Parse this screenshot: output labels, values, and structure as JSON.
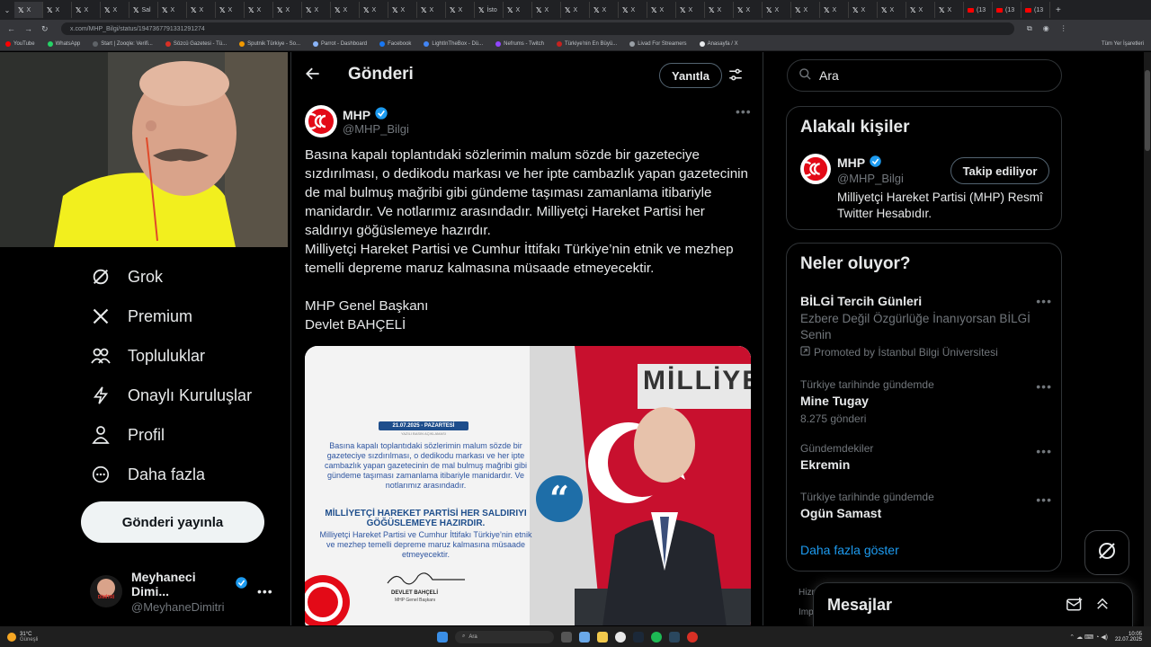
{
  "browser": {
    "tabs": [
      {
        "label": "X"
      },
      {
        "label": "X"
      },
      {
        "label": "X"
      },
      {
        "label": "X"
      },
      {
        "label": "Sal"
      },
      {
        "label": "X"
      },
      {
        "label": "X"
      },
      {
        "label": "X"
      },
      {
        "label": "X"
      },
      {
        "label": "X"
      },
      {
        "label": "X"
      },
      {
        "label": "X"
      },
      {
        "label": "X"
      },
      {
        "label": "X"
      },
      {
        "label": "X"
      },
      {
        "label": "X"
      },
      {
        "label": "İsto"
      },
      {
        "label": "X"
      },
      {
        "label": "X"
      },
      {
        "label": "X"
      },
      {
        "label": "X"
      },
      {
        "label": "X"
      },
      {
        "label": "X"
      },
      {
        "label": "X"
      },
      {
        "label": "X"
      },
      {
        "label": "X"
      },
      {
        "label": "X"
      },
      {
        "label": "X"
      },
      {
        "label": "X"
      },
      {
        "label": "X"
      },
      {
        "label": "X"
      },
      {
        "label": "X"
      },
      {
        "label": "X"
      },
      {
        "label": "(13"
      },
      {
        "label": "(13"
      },
      {
        "label": "(13"
      }
    ],
    "url": "x.com/MHP_Bilgi/status/1947367791331291274",
    "bookmarks": [
      {
        "label": "YouTube",
        "color": "#ff0000"
      },
      {
        "label": "WhatsApp",
        "color": "#25d366"
      },
      {
        "label": "Start | Zooqle: Verifi...",
        "color": "#5f6368"
      },
      {
        "label": "Sözcü Gazetesi - Tü...",
        "color": "#d93025"
      },
      {
        "label": "Sputnik Türkiye - So...",
        "color": "#f29900"
      },
      {
        "label": "Parrot - Dashboard",
        "color": "#8ab4f8"
      },
      {
        "label": "Facebook",
        "color": "#1877f2"
      },
      {
        "label": "LightInTheBox - Dü...",
        "color": "#4285f4"
      },
      {
        "label": "Nefrums - Twitch",
        "color": "#9146ff"
      },
      {
        "label": "Türkiye'nin En Büyü...",
        "color": "#c5221f"
      },
      {
        "label": "Livad For Streamers",
        "color": "#9aa0a6"
      },
      {
        "label": "Anasayfa / X",
        "color": "#e8eaed"
      }
    ],
    "bookmarks_right": "Tüm Yer İşaretleri"
  },
  "sidebar": {
    "items": [
      {
        "label": "Grok",
        "icon": "grok-icon"
      },
      {
        "label": "Premium",
        "icon": "x-logo-icon"
      },
      {
        "label": "Topluluklar",
        "icon": "communities-icon"
      },
      {
        "label": "Onaylı Kuruluşlar",
        "icon": "lightning-icon"
      },
      {
        "label": "Profil",
        "icon": "profile-icon"
      },
      {
        "label": "Daha fazla",
        "icon": "more-circle-icon"
      }
    ],
    "post_button": "Gönderi yayınla",
    "account": {
      "name": "Meyhaneci Dimi...",
      "handle": "@MeyhaneDimitri",
      "avatar_text": "DİMİTRİ"
    }
  },
  "main": {
    "title": "Gönderi",
    "reply_button": "Yanıtla",
    "author_name": "MHP",
    "author_handle": "@MHP_Bilgi",
    "post_text": "Basına kapalı toplantıdaki sözlerimin malum sözde bir gazeteciye sızdırılması, o dedikodu markası ve her ipte cambazlık yapan gazetecinin de mal bulmuş mağribi gibi gündeme taşıması zamanlama itibariyle manidardır. Ve notlarımız arasındadır. Milliyetçi Hareket Partisi her saldırıyı göğüslemeye hazırdır.\nMilliyetçi Hareket Partisi ve Cumhur İttifakı Türkiye’nin etnik ve mezhep temelli depreme maruz kalmasına müsaade etmeyecektir.\n\nMHP Genel Başkanı\nDevlet BAHÇELİ",
    "image": {
      "date_banner": "21.07.2025 - PAZARTESİ",
      "date_sub": "YAZILI BASIN AÇIKLAMASI",
      "body": "Basına kapalı toplantıdaki sözlerimin malum sözde bir gazeteciye sızdırılması, o dedikodu markası ve her ipte cambazlık yapan gazetecinin de mal bulmuş mağribi gibi gündeme taşıması zamanlama itibariyle manidardır. Ve notlarımız arasındadır.",
      "highlight": "MİLLİYETÇİ HAREKET PARTİSİ HER SALDIRIYI GÖĞÜSLEMEYE HAZIRDIR.",
      "body2": "Milliyetçi Hareket Partisi ve Cumhur İttifakı Türkiye’nin etnik ve mezhep temelli depreme maruz kalmasına müsaade etmeyecektir.",
      "signature_name": "DEVLET BAHÇELİ",
      "signature_title": "MHP Genel Başkanı",
      "wall_text": "MİLLİYET"
    }
  },
  "right": {
    "search_placeholder": "Ara",
    "related_title": "Alakalı kişiler",
    "related": {
      "name": "MHP",
      "handle": "@MHP_Bilgi",
      "follow_label": "Takip ediliyor",
      "bio": "Milliyetçi Hareket Partisi (MHP) Resmî Twitter Hesabıdır."
    },
    "trends_title": "Neler oluyor?",
    "promo": {
      "name": "BİLGİ Tercih Günleri",
      "desc": "Ezbere Değil Özgürlüğe İnanıyorsan BİLGİ Senin",
      "promoted": "Promoted by İstanbul Bilgi Üniversitesi"
    },
    "trends": [
      {
        "meta": "Türkiye tarihinde gündemde",
        "name": "Mine Tugay",
        "count": "8.275 gönderi"
      },
      {
        "meta": "Gündemdekiler",
        "name": "Ekremin",
        "count": ""
      },
      {
        "meta": "Türkiye tarihinde gündemde",
        "name": "Ogün Samast",
        "count": ""
      }
    ],
    "show_more": "Daha fazla göster",
    "footer_partial_1": "Hizr",
    "footer_partial_2": "Impr",
    "messages_label": "Mesajlar"
  },
  "taskbar": {
    "weather_temp": "31°C",
    "weather_desc": "Güneşli",
    "search": "Ara",
    "time": "10:05",
    "date": "22.07.2025"
  },
  "colors": {
    "accent": "#1d9bf0",
    "verified": "#1d9bf0",
    "mhp_red": "#e30a17"
  }
}
